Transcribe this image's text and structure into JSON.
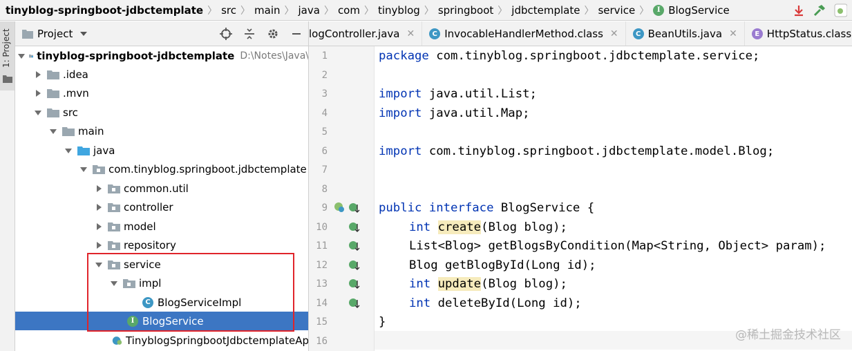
{
  "breadcrumb": [
    {
      "label": "tinyblog-springboot-jdbctemplate",
      "bold": true
    },
    {
      "label": "src"
    },
    {
      "label": "main"
    },
    {
      "label": "java"
    },
    {
      "label": "com"
    },
    {
      "label": "tinyblog"
    },
    {
      "label": "springboot"
    },
    {
      "label": "jdbctemplate"
    },
    {
      "label": "service"
    },
    {
      "label": "BlogService",
      "icon": "I"
    }
  ],
  "stripe": {
    "label": "1: Project"
  },
  "project": {
    "title": "Project",
    "tree": [
      {
        "label": "tinyblog-springboot-jdbctemplate",
        "hint": "D:\\Notes\\Java\\",
        "bold": true
      },
      {
        "label": ".idea"
      },
      {
        "label": ".mvn"
      },
      {
        "label": "src"
      },
      {
        "label": "main"
      },
      {
        "label": "java"
      },
      {
        "label": "com.tinyblog.springboot.jdbctemplate"
      },
      {
        "label": "common.util"
      },
      {
        "label": "controller"
      },
      {
        "label": "model"
      },
      {
        "label": "repository"
      },
      {
        "label": "service"
      },
      {
        "label": "impl"
      },
      {
        "label": "BlogServiceImpl",
        "icon": "C"
      },
      {
        "label": "BlogService",
        "icon": "I"
      },
      {
        "label": "TinyblogSpringbootJdbctemplateAp"
      }
    ]
  },
  "tabs": [
    {
      "label": "logController.java",
      "icon": ""
    },
    {
      "label": "InvocableHandlerMethod.class",
      "icon": "C"
    },
    {
      "label": "BeanUtils.java",
      "icon": "C"
    },
    {
      "label": "HttpStatus.class",
      "icon": "E"
    }
  ],
  "code": {
    "line_numbers": [
      "1",
      "2",
      "3",
      "4",
      "5",
      "6",
      "7",
      "8",
      "9",
      "10",
      "11",
      "12",
      "13",
      "14",
      "15",
      "16"
    ],
    "l1": {
      "kw": "package",
      "rest": " com.tinyblog.springboot.jdbctemplate.service;"
    },
    "l3": {
      "kw": "import",
      "rest": " java.util.List;"
    },
    "l4": {
      "kw": "import",
      "rest": " java.util.Map;"
    },
    "l6": {
      "kw": "import",
      "rest": " com.tinyblog.springboot.jdbctemplate.model.Blog;"
    },
    "l9": {
      "kw1": "public",
      "kw2": "interface",
      "rest": " BlogService {"
    },
    "l10": {
      "kw": "int",
      "method": "create",
      "rest": "(Blog blog);"
    },
    "l11": {
      "text": "List<Blog> getBlogsByCondition(Map<String, Object> param);"
    },
    "l12": {
      "text": "Blog getBlogById(Long id);"
    },
    "l13": {
      "kw": "int",
      "method": "update",
      "rest": "(Blog blog);"
    },
    "l14": {
      "kw": "int",
      "rest": " deleteById(Long id);"
    },
    "l15": {
      "text": "}"
    }
  },
  "watermark": "@稀土掘金技术社区",
  "colors": {
    "selection": "#3c76c3",
    "keyword": "#0033b3",
    "highlight_box": "#e0242a",
    "interface_icon": "#59a869",
    "class_icon": "#3d97c4"
  }
}
